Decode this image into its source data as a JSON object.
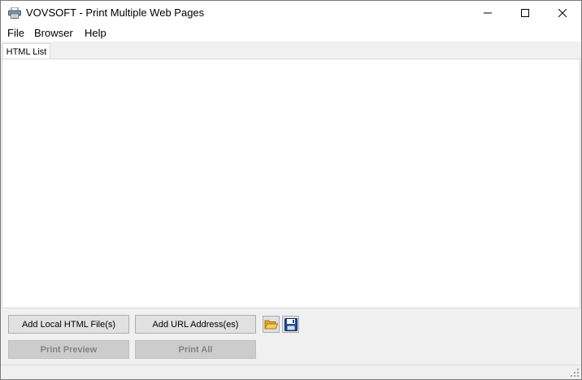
{
  "window": {
    "title": "VOVSOFT - Print Multiple Web Pages",
    "app_icon": "printer-icon",
    "caption_buttons": [
      "minimize-icon",
      "maximize-icon",
      "close-icon"
    ]
  },
  "menu": {
    "file": "File",
    "browser": "Browser",
    "help": "Help"
  },
  "tabs": [
    {
      "label": "HTML List",
      "active": true
    }
  ],
  "html_list": {
    "items": []
  },
  "buttons": {
    "add_local": "Add Local HTML File(s)",
    "add_url": "Add URL Address(es)",
    "print_preview": "Print Preview",
    "print_all": "Print All",
    "open_icon": "folder-open-icon",
    "save_icon": "floppy-disk-icon"
  },
  "colors": {
    "window_bg": "#f0f0f0",
    "panel_bg": "#ffffff",
    "button_bg": "#e1e1e1",
    "disabled_text": "#838383"
  }
}
